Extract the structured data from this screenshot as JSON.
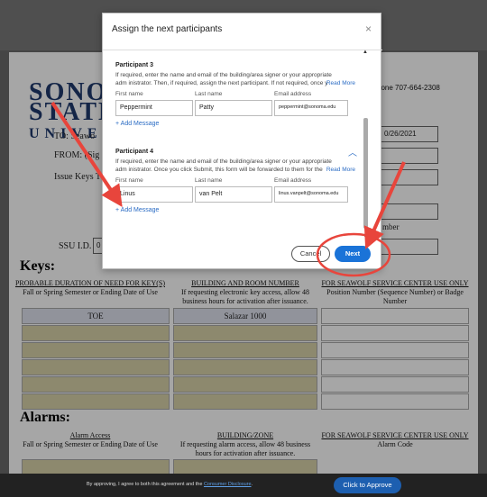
{
  "document": {
    "logo": [
      "SONOMA",
      "STATE",
      "UNIVERSITY"
    ],
    "phone_text": "hone 707-664-2308",
    "to_label": "TO: Seawo",
    "from_label": "FROM: (Sig",
    "issue_label": "Issue Keys T",
    "date_value": "0/26/2021",
    "number_label": "mber",
    "ssu_label": "SSU I.D.",
    "ssu_value": "0",
    "keys_title": "Keys:",
    "alarms_title": "Alarms:",
    "key_headers": [
      {
        "title": "PROBABLE DURATION OF NEED FOR KEY(S)",
        "sub": "Fall or Spring Semester or Ending Date of Use"
      },
      {
        "title": "BUILDING AND ROOM NUMBER",
        "sub": "If requesting electronic key access, allow 48 business hours for activation after issuance."
      },
      {
        "title": "FOR SEAWOLF SERVICE CENTER USE ONLY",
        "sub": "Position Number (Sequence Number) or Badge Number"
      }
    ],
    "key_row1": [
      "TOE",
      "Salazar 1000",
      ""
    ],
    "alarm_headers": [
      {
        "title": "Alarm Access",
        "sub": "Fall or Spring Semester or Ending Date of Use"
      },
      {
        "title": "BUILDING/ZONE",
        "sub": "If requesting alarm access, allow 48 business hours for activation after issuance."
      },
      {
        "title": "FOR SEAWOLF SERVICE CENTER USE ONLY",
        "sub": "Alarm Code"
      }
    ]
  },
  "dialog": {
    "title": "Assign the next participants",
    "close": "×",
    "participants": [
      {
        "title": "Participant 3",
        "desc": "If required, enter the name and email of the building/area signer or your appropriate adm inistrator. Then, if required, assign the next participant. If not required, once y",
        "read_more": "Read More",
        "labels": [
          "First name",
          "Last name",
          "Email address"
        ],
        "first": "Peppermint",
        "last": "Patty",
        "email": "peppermint@sonoma.edu",
        "add_message": "+ Add Message"
      },
      {
        "title": "Participant 4",
        "desc": "If required, enter the name and email of the building/area signer or your appropriate adm inistrator. Once you click Submit, this form will be forwarded to them for the",
        "read_more": "Read More",
        "labels": [
          "First name",
          "Last name",
          "Email address"
        ],
        "first": "Linus",
        "last": "van Pelt",
        "email": "linus.vanpelt@sonoma.edu",
        "add_message": "+ Add Message"
      }
    ],
    "cancel_label": "Cancel",
    "next_label": "Next"
  },
  "bottom_bar": {
    "agree_prefix": "By approving, I agree to both this agreement and the",
    "agree_link": "Consumer Disclosure",
    "agree_suffix": ".",
    "approve_label": "Click to Approve"
  },
  "colors": {
    "accent": "#1a73d8",
    "annotation_red": "#e8453c",
    "field_tan": "#d9d3a9"
  }
}
